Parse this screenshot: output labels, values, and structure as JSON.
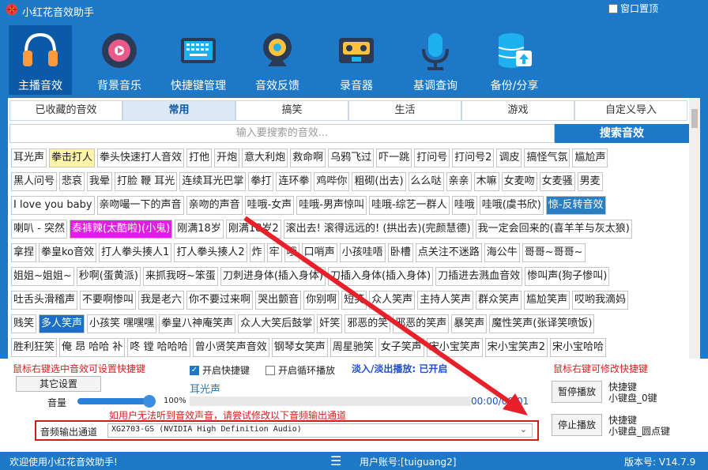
{
  "app": {
    "title": "小红花音效助手",
    "topmost_label": "窗口置顶"
  },
  "toolbar": [
    {
      "label": "主播音效",
      "active": true
    },
    {
      "label": "背景音乐"
    },
    {
      "label": "快捷键管理"
    },
    {
      "label": "音效反馈"
    },
    {
      "label": "录音器"
    },
    {
      "label": "基调查询"
    },
    {
      "label": "备份/分享"
    }
  ],
  "tabs": [
    "已收藏的音效",
    "常用",
    "搞笑",
    "生活",
    "游戏",
    "自定义导入"
  ],
  "search": {
    "placeholder": "输入要搜索的音效...",
    "button": "搜索音效"
  },
  "fav_tag": "已收藏",
  "sound_rows": [
    [
      {
        "t": "耳光声"
      },
      {
        "t": "拳击打人",
        "h": "y"
      },
      {
        "t": "拳头快速打人音效"
      },
      {
        "t": "打他"
      },
      {
        "t": "开炮"
      },
      {
        "t": "意大利炮"
      },
      {
        "t": "救命啊"
      },
      {
        "t": "乌鸦飞过"
      },
      {
        "t": "吓一跳"
      },
      {
        "t": "打问号"
      },
      {
        "t": "打问号2"
      },
      {
        "t": "调皮"
      },
      {
        "t": "搞怪气氛"
      },
      {
        "t": "尴尬声"
      }
    ],
    [
      {
        "t": "黑人问号"
      },
      {
        "t": "悲哀"
      },
      {
        "t": "我晕"
      },
      {
        "t": "打脸 鞭 耳光"
      },
      {
        "t": "连续耳光巴掌"
      },
      {
        "t": "拳打"
      },
      {
        "t": "连环拳"
      },
      {
        "t": "鸡哔你"
      },
      {
        "t": "粗砌(出去)"
      },
      {
        "t": "么么哒"
      },
      {
        "t": "亲亲"
      },
      {
        "t": "木嘛"
      },
      {
        "t": "女麦吻"
      },
      {
        "t": "女麦骚"
      },
      {
        "t": "男麦"
      }
    ],
    [
      {
        "t": "I love you baby"
      },
      {
        "t": "亲吻嘬一下的声音"
      },
      {
        "t": "亲吻的声音"
      },
      {
        "t": "哇哦-女声"
      },
      {
        "t": "哇哦-男声惊叫"
      },
      {
        "t": "哇哦-综艺一群人"
      },
      {
        "t": "哇哦"
      },
      {
        "t": "哇哦(虞书欣)"
      },
      {
        "t": "惊-反转音效",
        "h": "b"
      }
    ],
    [
      {
        "t": "喇叭 - 突然"
      },
      {
        "t": "泰裤辣(太酷啦)(小鬼)",
        "h": "m"
      },
      {
        "t": "刚满18岁"
      },
      {
        "t": "刚满18岁2"
      },
      {
        "t": "滚出去! 滚得远远的! (拱出去)(完颜慧德)"
      },
      {
        "t": "我一定会回来的(喜羊羊与灰太狼)"
      }
    ],
    [
      {
        "t": "拿捏"
      },
      {
        "t": "拳皇ko音效"
      },
      {
        "t": "打人拳头揍人1"
      },
      {
        "t": "打人拳头揍人2"
      },
      {
        "t": "炸"
      },
      {
        "t": "牢"
      },
      {
        "t": "哦"
      },
      {
        "t": "口哨声"
      },
      {
        "t": "小孩哇唔"
      },
      {
        "t": "卧槽"
      },
      {
        "t": "点关注不迷路"
      },
      {
        "t": "海公牛"
      },
      {
        "t": "哥哥~哥哥~"
      }
    ],
    [
      {
        "t": "姐姐~姐姐~"
      },
      {
        "t": "秒啊(蛋黄派)"
      },
      {
        "t": "来抓我呀~笨蛋"
      },
      {
        "t": "刀刺进身体(插入身体)"
      },
      {
        "t": "刀插入身体(插入身体)"
      },
      {
        "t": "刀插进去溅血音效"
      },
      {
        "t": "惨叫声(狗子惨叫)"
      }
    ],
    [
      {
        "t": "吐舌头滑稽声"
      },
      {
        "t": "不要啊惨叫"
      },
      {
        "t": "我是老六"
      },
      {
        "t": "你不要过来啊"
      },
      {
        "t": "哭出颤音"
      },
      {
        "t": "你别啊"
      },
      {
        "t": "短笑"
      },
      {
        "t": "众人笑声"
      },
      {
        "t": "主持人笑声"
      },
      {
        "t": "群众笑声"
      },
      {
        "t": "尴尬笑声"
      },
      {
        "t": "哎哟我滴妈"
      }
    ],
    [
      {
        "t": "贱笑"
      },
      {
        "t": "多人笑声",
        "h": "t"
      },
      {
        "t": "小孩笑 嘿嘿嘿"
      },
      {
        "t": "拳皇八神庵笑声"
      },
      {
        "t": "众人大笑后鼓掌"
      },
      {
        "t": "奸笑"
      },
      {
        "t": "邪恶的笑"
      },
      {
        "t": "邪恶的笑声"
      },
      {
        "t": "暴笑声"
      },
      {
        "t": "魔性笑声(张译笑喷饭)"
      }
    ],
    [
      {
        "t": "胜利狂笑"
      },
      {
        "t": "俺 昂 哈哈 补"
      },
      {
        "t": "咚 镗 哈哈哈"
      },
      {
        "t": "曾小贤笑声音效"
      },
      {
        "t": "钢琴女笑声"
      },
      {
        "t": "周星驰笑"
      },
      {
        "t": "女子笑声"
      },
      {
        "t": "宋小宝笑声"
      },
      {
        "t": "宋小宝笑声2"
      },
      {
        "t": "宋小宝哈哈"
      }
    ]
  ],
  "bottom": {
    "hint_left": "鼠标右键选中音效可设置快捷键",
    "hint_right": "鼠标右键可修改快捷键",
    "hotkey_enable": "开启快捷键",
    "loop_enable": "开启循环播放",
    "fade_label": "淡入/淡出播放: 已开启",
    "other_settings": "其它设置",
    "volume_label": "音量",
    "volume_percent": "100%",
    "volume_value": 1.0,
    "now_playing": "耳光声",
    "time": "00:00/00:01",
    "pause_button": "暂停播放",
    "pause_key": "快捷键\n小键盘_0键",
    "stop_button": "停止播放",
    "stop_key": "快捷键\n小键盘_圆点键",
    "audio_hint": "如用户无法听到音效声音，请尝试修改以下音频输出通道",
    "audio_label": "音频输出通道",
    "audio_device": "XG2703-GS (NVIDIA High Definition Audio)"
  },
  "status": {
    "welcome": "欢迎使用小红花音效助手!",
    "account": "用户账号:[tuiguang2]",
    "version": "版本号: V14.7.9"
  },
  "colors": {
    "primary": "#1d78c8",
    "highlight_yellow": "#fff3a8",
    "highlight_magenta": "#e020e0",
    "fav_purple": "#7a1ea8",
    "hint_red": "#d82020",
    "arrow_red": "#e8202a"
  }
}
